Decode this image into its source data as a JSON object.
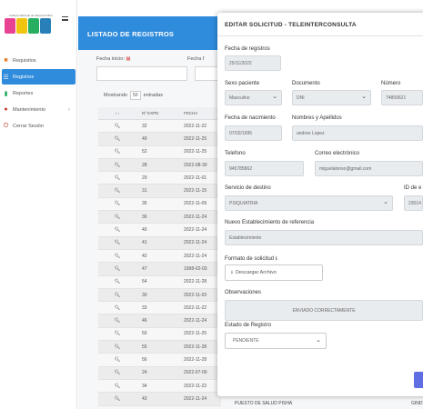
{
  "brand": {
    "tagline": "Instituto Nacional de Salud del Niño",
    "colors": [
      "#e84393",
      "#f1c40f",
      "#27ae60",
      "#2980b9"
    ]
  },
  "sidebar": {
    "items": [
      {
        "label": "Requisitos",
        "icon": "folder-icon",
        "color": "#e67e22",
        "active": false
      },
      {
        "label": "Registros",
        "icon": "list-icon",
        "color": "#ffffff",
        "active": true
      },
      {
        "label": "Reportes",
        "icon": "bar-chart-icon",
        "color": "#27ae60",
        "active": false
      },
      {
        "label": "Mantenimiento",
        "icon": "user-icon",
        "color": "#c0392b",
        "active": false
      },
      {
        "label": "Cerrar Sesión",
        "icon": "power-icon",
        "color": "#c0392b",
        "active": false
      }
    ]
  },
  "listing": {
    "title": "LISTADO DE REGISTROS",
    "filter_start_label": "Fecha inicio:",
    "filter_end_label": "Fecha f",
    "show_label": "Mostrando",
    "show_value": "50",
    "entries_label": "entradas",
    "columns": [
      "↑↓",
      "Nº EXPD",
      "FECHA"
    ],
    "rows": [
      {
        "expd": "32",
        "fecha": "2022-11-22"
      },
      {
        "expd": "49",
        "fecha": "2022-11-25"
      },
      {
        "expd": "52",
        "fecha": "2022-11-25"
      },
      {
        "expd": "28",
        "fecha": "2022-08-30"
      },
      {
        "expd": "29",
        "fecha": "2022-11-01"
      },
      {
        "expd": "31",
        "fecha": "2022-11-15"
      },
      {
        "expd": "35",
        "fecha": "2022-11-09"
      },
      {
        "expd": "36",
        "fecha": "2022-11-24"
      },
      {
        "expd": "40",
        "fecha": "2022-11-24"
      },
      {
        "expd": "41",
        "fecha": "2022-11-24"
      },
      {
        "expd": "42",
        "fecha": "2022-11-24"
      },
      {
        "expd": "47",
        "fecha": "1998-02-03"
      },
      {
        "expd": "54",
        "fecha": "2022-11-28"
      },
      {
        "expd": "30",
        "fecha": "2022-11-03"
      },
      {
        "expd": "33",
        "fecha": "2022-11-22"
      },
      {
        "expd": "46",
        "fecha": "2022-11-24"
      },
      {
        "expd": "50",
        "fecha": "2022-11-25"
      },
      {
        "expd": "55",
        "fecha": "2022-11-28"
      },
      {
        "expd": "56",
        "fecha": "2022-11-28"
      },
      {
        "expd": "24",
        "fecha": "2022-07-09"
      },
      {
        "expd": "34",
        "fecha": "2022-11-22"
      },
      {
        "expd": "43",
        "fecha": "2022-11-24"
      }
    ],
    "peek_text": "PUESTO DE SALUD PISHA",
    "peek_text_right": "GIND"
  },
  "modal": {
    "title": "EDITAR SOLICITUD - TELEINTERCONSULTA",
    "fecha_registro_label": "Fecha de registros",
    "fecha_registro_value": "25/11/2022",
    "sexo_label": "Sexo paciente",
    "sexo_value": "Masculino",
    "documento_label": "Documento",
    "documento_value": "DNI",
    "numero_label": "Número",
    "numero_value": "74859621",
    "nacimiento_label": "Fecha de nacimiento",
    "nacimiento_value": "07/02/1995",
    "nombres_label": "Nombres y Apellidos",
    "nombres_value": "andree Lopez",
    "telefono_label": "Telefono",
    "telefono_value": "945785862",
    "correo_label": "Correo electrónico",
    "correo_value": "miguelalonso@gmail.com",
    "servicio_label": "Servicio de destino",
    "servicio_value": "PSIQUIATRIA",
    "id_label": "ID de e",
    "id_value": "23014",
    "nuevo_label": "Nuevo Establecimiento de referencia",
    "nuevo_placeholder": "Establecimiento",
    "formato_label": "Formato de solicitud",
    "descargar_label": "Descargar Archivo",
    "observ_label": "Observaciones",
    "observ_value": "ENVIADO CORRECTAMENTE",
    "estado_label": "Estado de Registro",
    "estado_value": "PENDIENTE"
  }
}
